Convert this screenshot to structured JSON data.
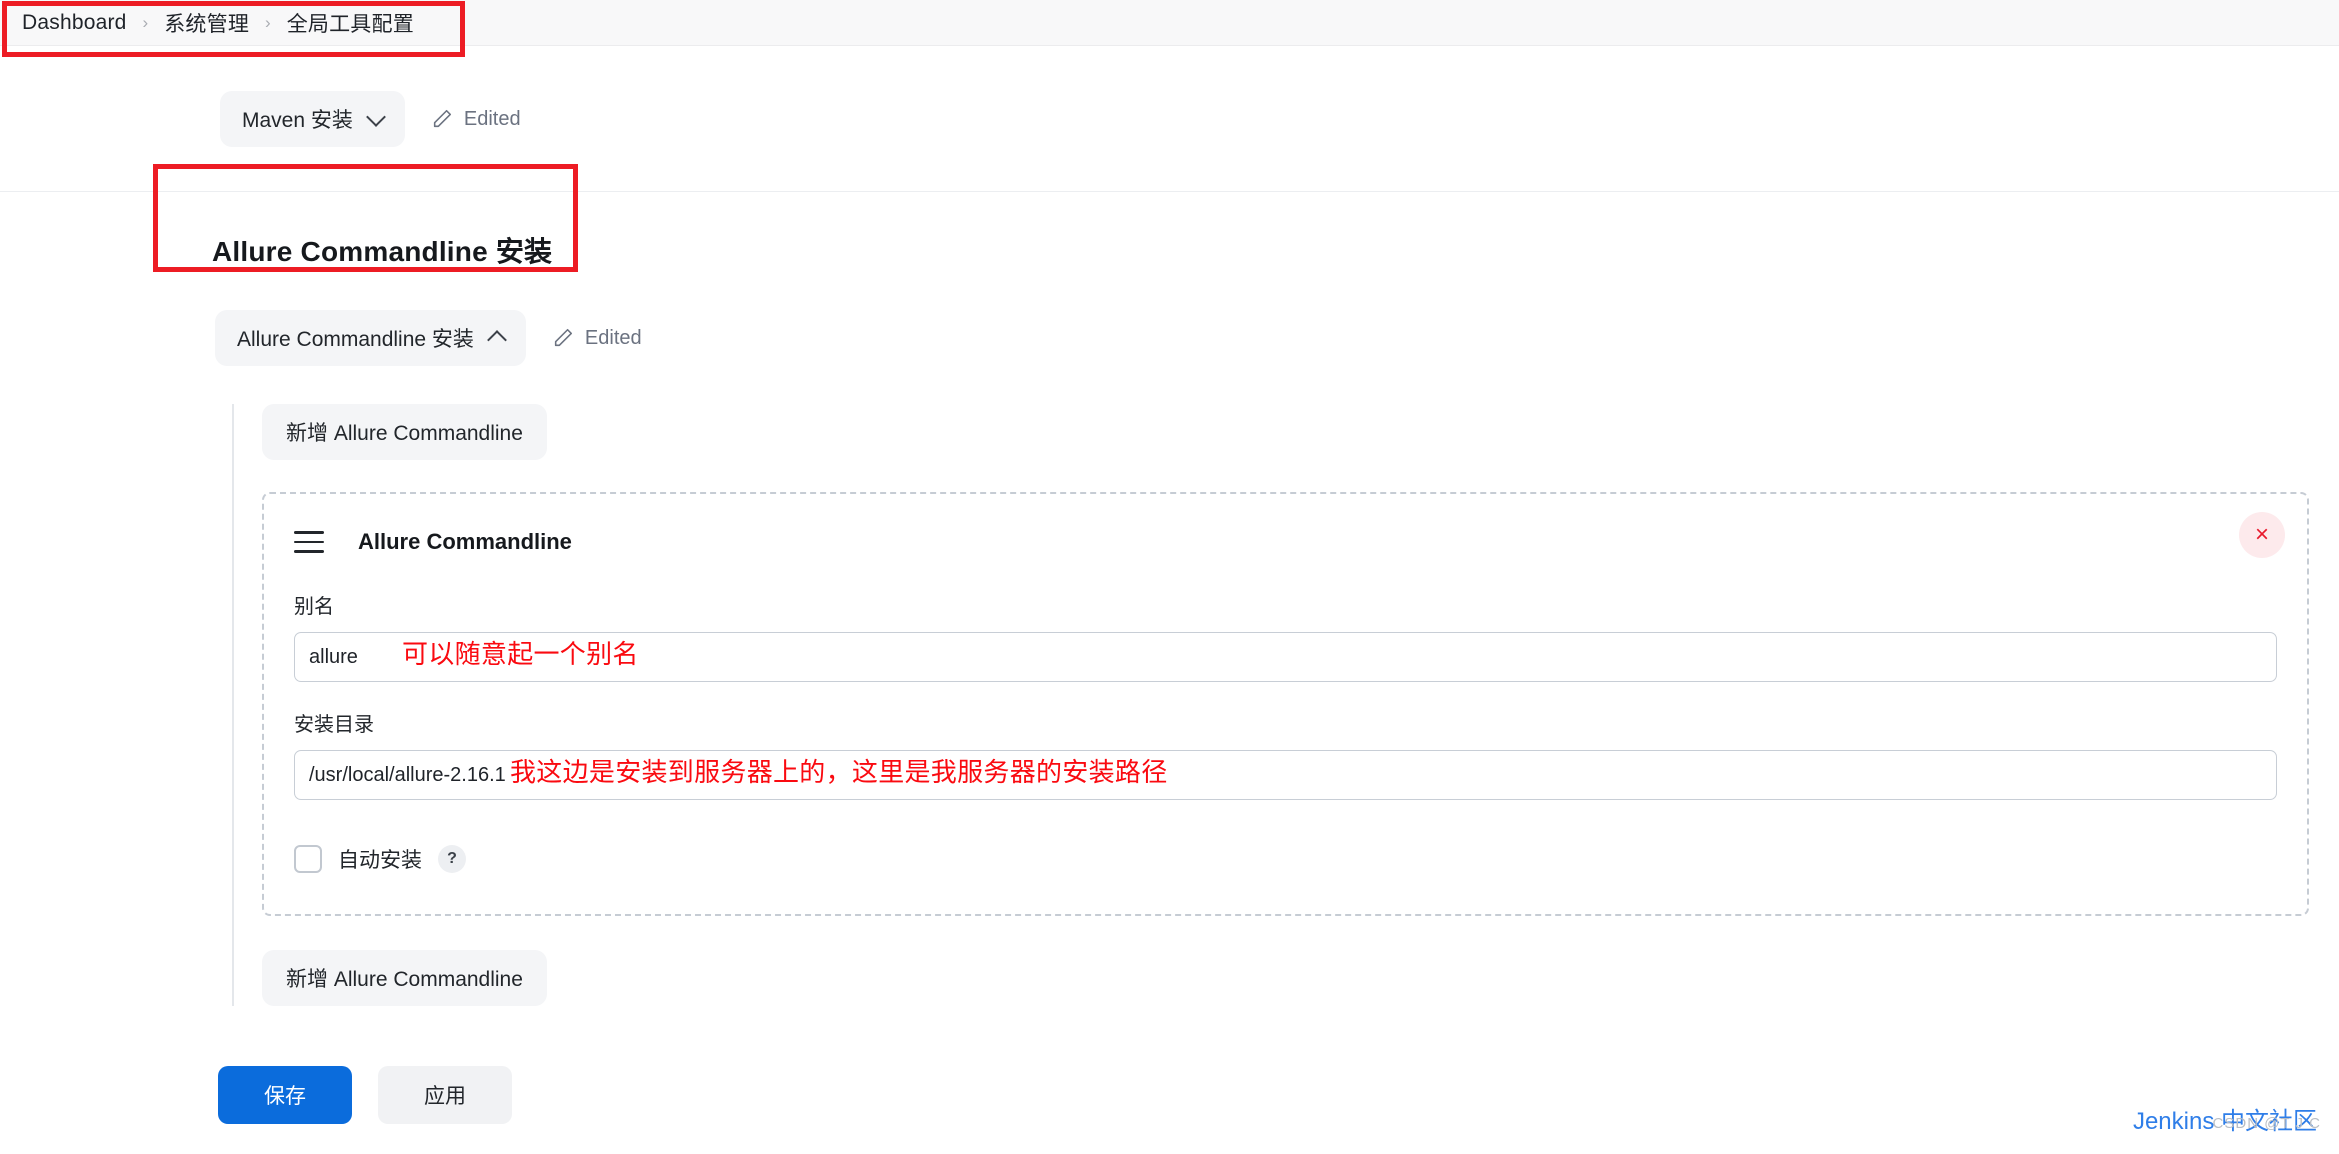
{
  "breadcrumb": {
    "items": [
      {
        "label": "Dashboard"
      },
      {
        "label": "系统管理"
      },
      {
        "label": "全局工具配置"
      }
    ],
    "separator": "›"
  },
  "maven_section": {
    "toggle_label": "Maven 安装",
    "chevron": "chevron-down",
    "edited_label": "Edited"
  },
  "allure_section": {
    "heading": "Allure Commandline 安装",
    "toggle_label": "Allure Commandline 安装",
    "chevron": "chevron-up",
    "edited_label": "Edited",
    "add_button_top": "新增 Allure Commandline",
    "add_button_bottom": "新增 Allure Commandline",
    "panel": {
      "title": "Allure Commandline",
      "close_label": "×",
      "fields": {
        "alias": {
          "label": "别名",
          "value": "allure",
          "placeholder": ""
        },
        "install_dir": {
          "label": "安装目录",
          "value": "/usr/local/allure-2.16.1",
          "placeholder": ""
        }
      },
      "auto_install": {
        "label": "自动安装",
        "checked": false,
        "help_label": "?"
      }
    }
  },
  "annotations": {
    "alias_note": "可以随意起一个别名",
    "path_note": "我这边是安装到服务器上的，这里是我服务器的安装路径",
    "box_color": "#ed1c24",
    "text_color": "#fa0a10"
  },
  "actions": {
    "save_label": "保存",
    "apply_label": "应用",
    "save_color": "#0b6cdc"
  },
  "watermark": {
    "primary": "Jenkins 中文社区",
    "secondary": "CSDN @T J C",
    "primary_color": "#2f7ee8"
  }
}
